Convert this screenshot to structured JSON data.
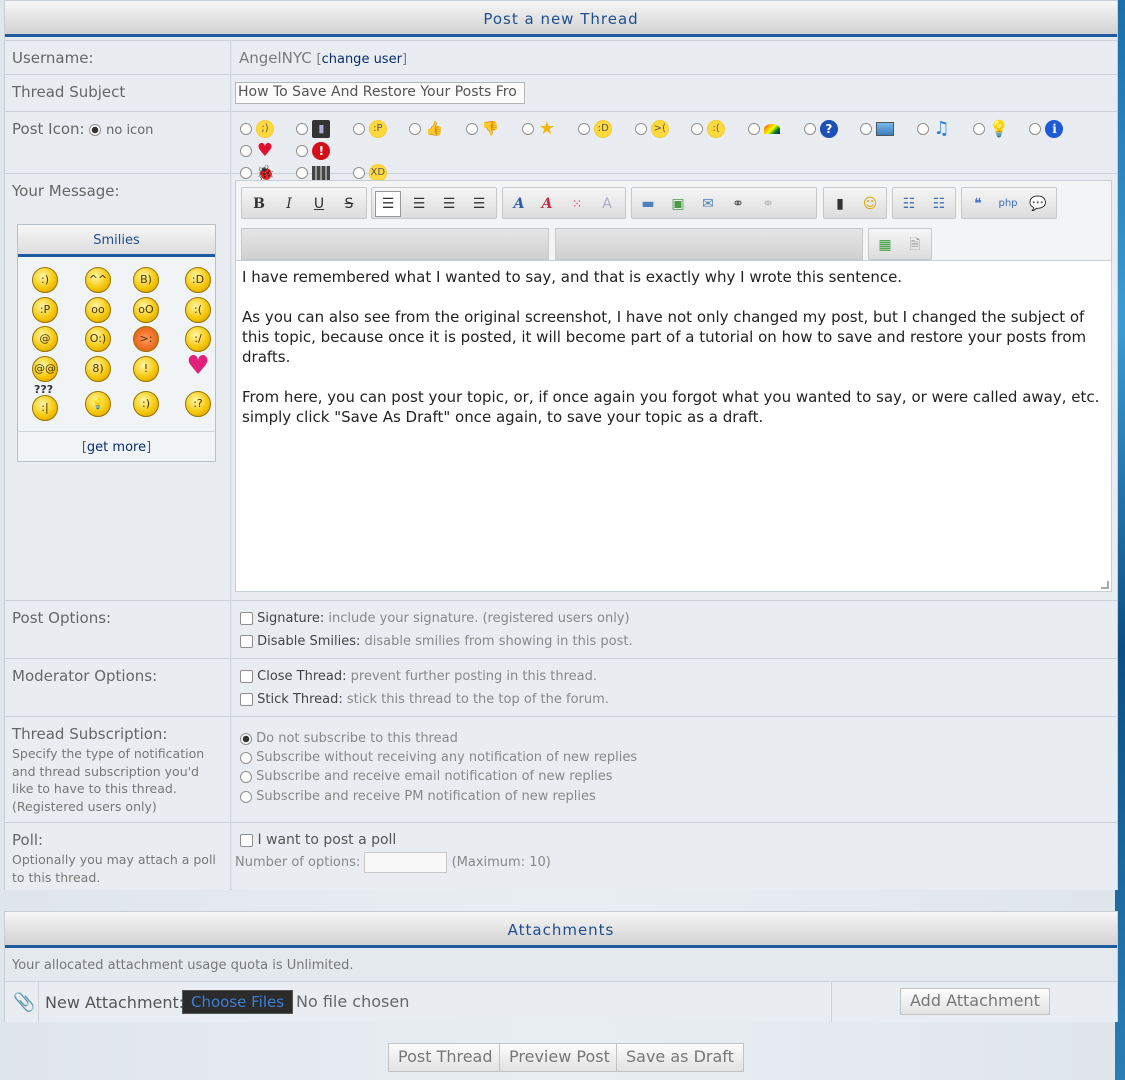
{
  "header": {
    "title": "Post a new Thread"
  },
  "username": {
    "label": "Username:",
    "value": "AngelNYC",
    "change_link": "change user",
    "bracket_open": "[",
    "bracket_close": "]"
  },
  "subject": {
    "label": "Thread Subject",
    "value": "How To Save And Restore Your Posts Fro"
  },
  "post_icon": {
    "label": "Post Icon:",
    "no_icon": "no icon",
    "icons": [
      "wink-smiley-icon",
      "film-icon",
      "tongue-smiley-icon",
      "thumbs-up-icon",
      "thumbs-down-icon",
      "star-icon",
      "grin-smiley-icon",
      "angry-smiley-icon",
      "frown-smiley-icon",
      "rainbow-icon",
      "question-icon",
      "picture-icon",
      "music-note-icon",
      "lightbulb-icon",
      "info-icon",
      "heart-icon",
      "exclamation-icon",
      "bug-icon",
      "clapperboard-icon",
      "laugh-smiley-icon"
    ]
  },
  "message": {
    "label": "Your Message:",
    "paragraphs": [
      "I have remembered what I wanted to say, and that is exactly why I wrote this sentence.",
      "As you can also see from the original screenshot, I have not only changed my post, but I changed the subject of this topic, because once it is posted, it will become part of a tutorial on how to save and restore your posts from drafts.",
      "From here, you can post your topic, or, if once again you forgot what you wanted to say, or were called away, etc. simply click \"Save As Draft\" once again, to save your topic as a draft."
    ]
  },
  "toolbar": {
    "bold": "B",
    "italic": "I",
    "underline": "U",
    "strike": "S"
  },
  "smilies": {
    "title": "Smilies",
    "get_more": "get more",
    "bracket_open": "[",
    "bracket_close": "]",
    "question_marks": "???",
    "exclaim": "!",
    "at": "@"
  },
  "post_options": {
    "label": "Post Options:",
    "signature_title": "Signature:",
    "signature_desc": "include your signature. (registered users only)",
    "smilies_title": "Disable Smilies:",
    "smilies_desc": "disable smilies from showing in this post."
  },
  "moderator_options": {
    "label": "Moderator Options:",
    "close_title": "Close Thread:",
    "close_desc": "prevent further posting in this thread.",
    "stick_title": "Stick Thread:",
    "stick_desc": "stick this thread to the top of the forum."
  },
  "subscription": {
    "label": "Thread Subscription:",
    "desc": "Specify the type of notification and thread subscription you'd like to have to this thread. (Registered users only)",
    "options": [
      "Do not subscribe to this thread",
      "Subscribe without receiving any notification of new replies",
      "Subscribe and receive email notification of new replies",
      "Subscribe and receive PM notification of new replies"
    ]
  },
  "poll": {
    "label": "Poll:",
    "desc": "Optionally you may attach a poll to this thread.",
    "checkbox": "I want to post a poll",
    "num_label": "Number of options:",
    "num_value": "",
    "max": "(Maximum: 10)"
  },
  "attachments": {
    "title": "Attachments",
    "quota": "Your allocated attachment usage quota is Unlimited.",
    "new_label": "New Attachment:",
    "choose": "Choose Files",
    "no_file": "No file chosen",
    "add": "Add Attachment"
  },
  "actions": {
    "post": "Post Thread",
    "preview": "Preview Post",
    "draft": "Save as Draft"
  }
}
